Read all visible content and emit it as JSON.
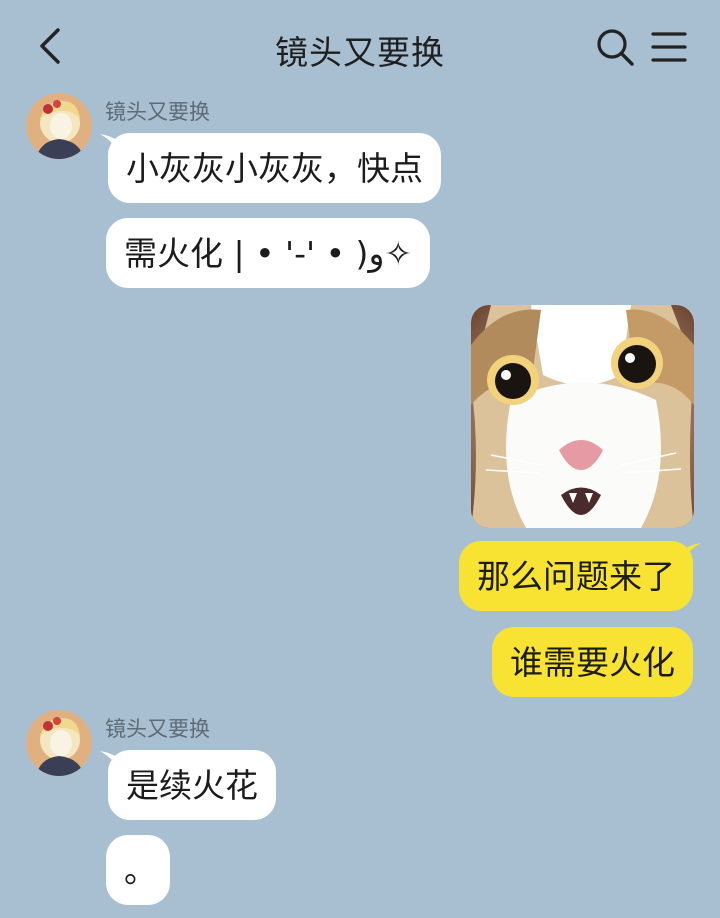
{
  "header": {
    "title": "镜头又要换",
    "back_icon": "chevron-left-icon",
    "search_icon": "search-icon",
    "menu_icon": "menu-icon"
  },
  "messages": [
    {
      "sender": "镜头又要换",
      "direction": "in",
      "texts": [
        "小灰灰小灰灰，快点",
        "需火化 | • '-' • )و✧"
      ]
    },
    {
      "direction": "out",
      "image": "cat-photo",
      "texts": [
        "那么问题来了",
        "谁需要火化"
      ]
    },
    {
      "sender": "镜头又要换",
      "direction": "in",
      "texts": [
        "是续火花",
        "。"
      ]
    }
  ],
  "colors": {
    "background": "#a8bfd2",
    "incoming_bubble": "#ffffff",
    "outgoing_bubble": "#f9e332"
  }
}
